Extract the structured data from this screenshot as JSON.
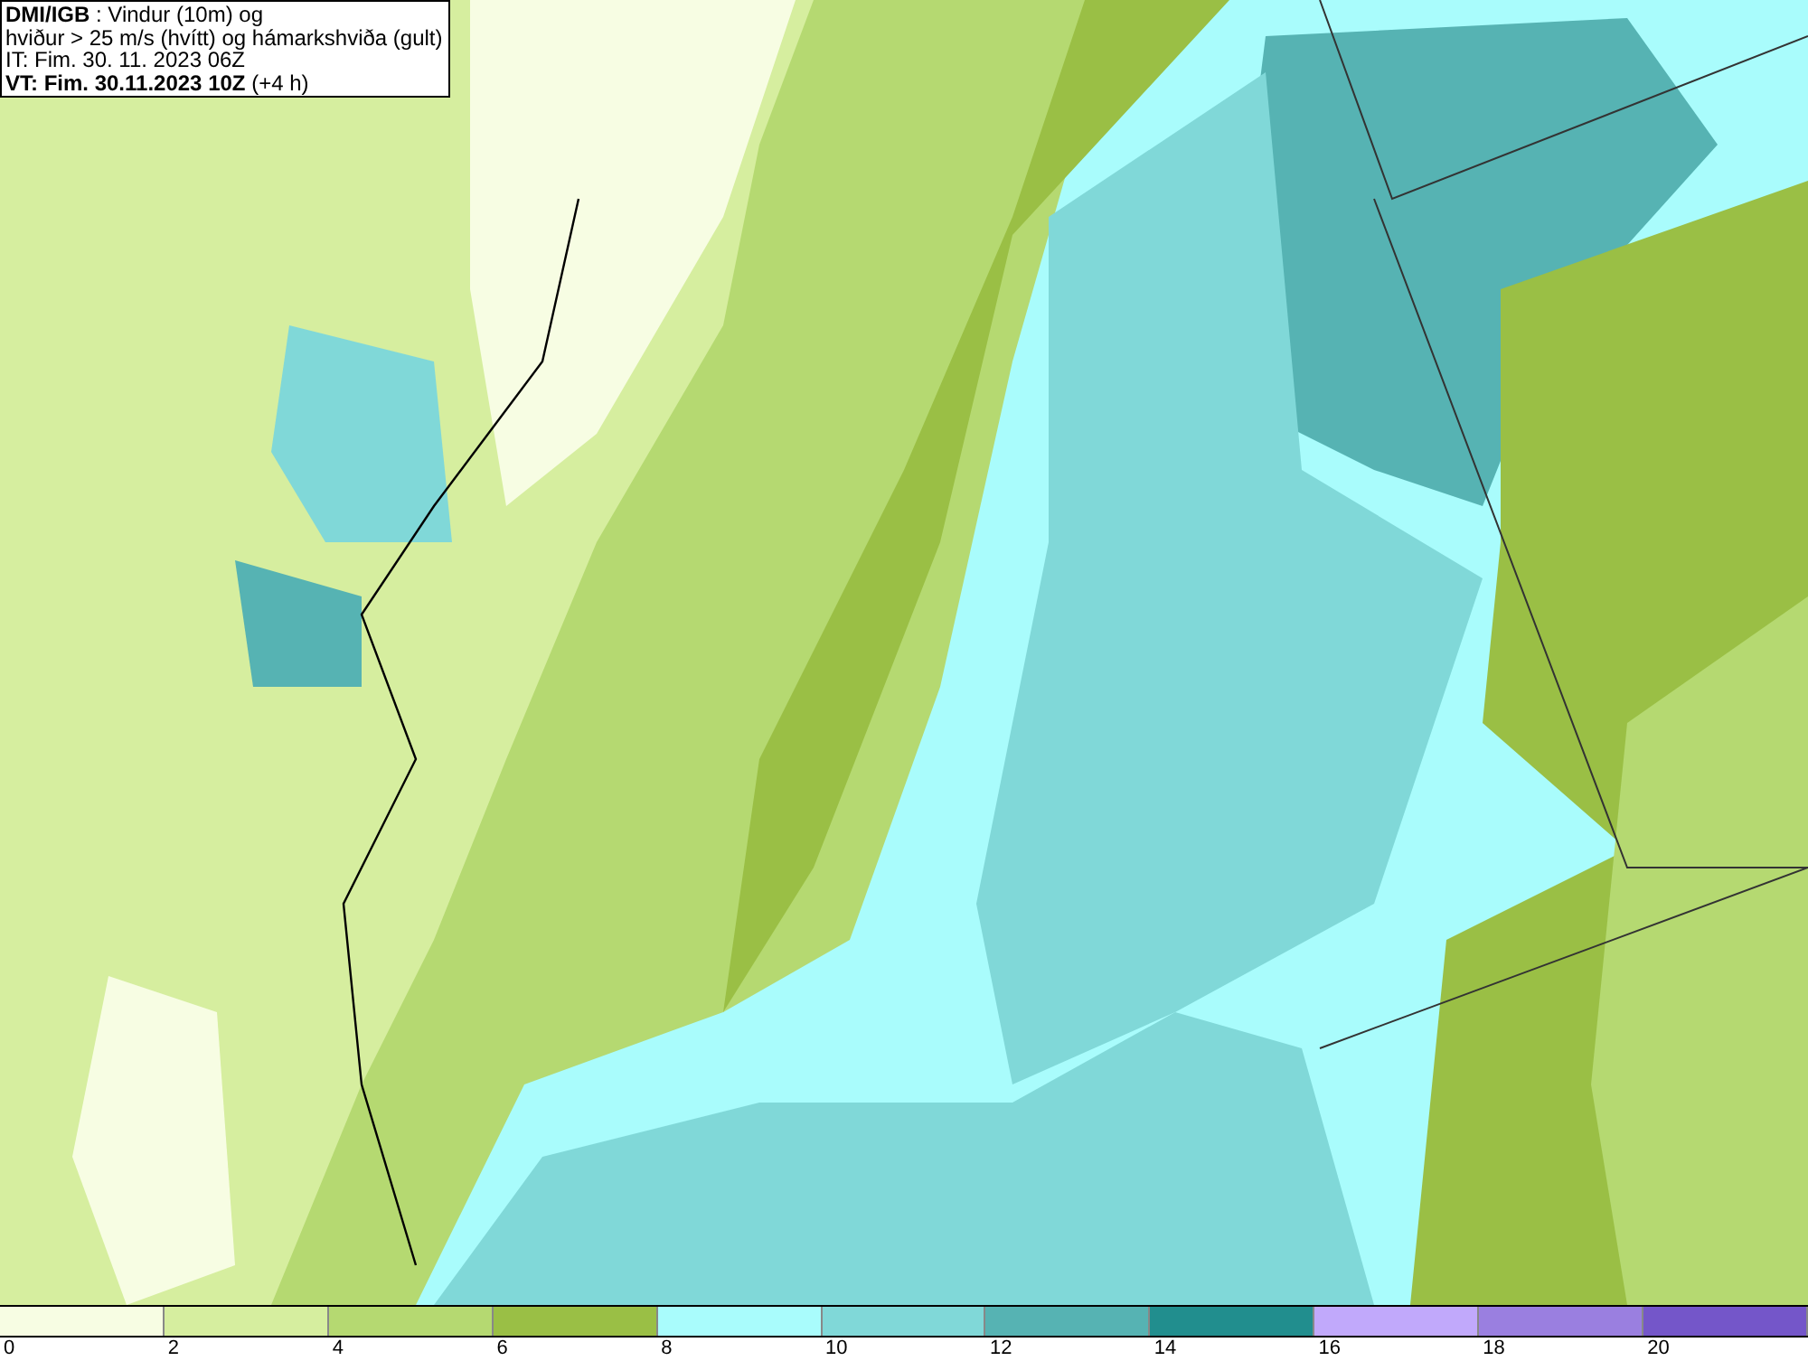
{
  "header": {
    "lines": [
      "**DMI/IGB** : Vindur (10m) og",
      "hviður > 25 m/s (hvítt) og hámarkshviða (gult)",
      "IT: Fim. 30. 11. 2023 06Z",
      "**VT: Fim. 30.11.2023 10Z** (+4 h)"
    ]
  },
  "legend": {
    "bins": [
      {
        "color": "#f7fde3"
      },
      {
        "color": "#d6ee9f"
      },
      {
        "color": "#b5d971"
      },
      {
        "color": "#9abf45"
      },
      {
        "color": "#a9fcfc"
      },
      {
        "color": "#80d8d8"
      },
      {
        "color": "#56b3b3"
      },
      {
        "color": "#218e8e"
      },
      {
        "color": "#c1a9fb"
      },
      {
        "color": "#9a7fe0"
      },
      {
        "color": "#7456c9"
      }
    ],
    "ticks": [
      "0",
      "2",
      "4",
      "6",
      "8",
      "10",
      "12",
      "14",
      "16",
      "18",
      "20"
    ]
  }
}
